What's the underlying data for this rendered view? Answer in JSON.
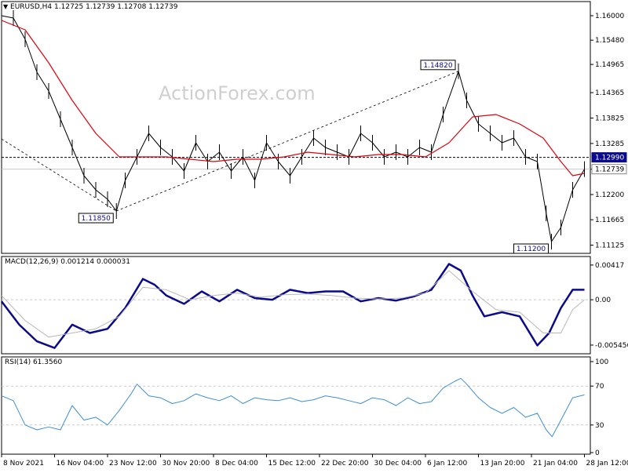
{
  "header": {
    "arrow": "▼",
    "symbol": "EURUSD,H4",
    "ohlc": "1.12725 1.12739 1.12708 1.12739"
  },
  "watermark": "ActionForex.com",
  "chart_data": [
    {
      "type": "line",
      "panel": "price",
      "ylim": [
        1.1095,
        1.163
      ],
      "yticks": [
        "1.16000",
        "1.15480",
        "1.14965",
        "1.14365",
        "1.13825",
        "1.13285",
        "1.12740",
        "1.12200",
        "1.11665",
        "1.11125"
      ],
      "ytick_values": [
        1.16,
        1.1548,
        1.14965,
        1.14365,
        1.13825,
        1.13285,
        1.1274,
        1.122,
        1.11665,
        1.11125
      ],
      "price_labels": [
        {
          "text": "1.12990",
          "value": 1.1299,
          "style": "dark"
        },
        {
          "text": "1.12739",
          "value": 1.12739,
          "style": "light"
        }
      ],
      "horizontal_line": 1.1299,
      "current_line": 1.12739,
      "annotations": [
        {
          "text": "1.11850",
          "value": 1.1185,
          "x": 0.195
        },
        {
          "text": "1.14820",
          "value": 1.1482,
          "x": 0.776
        },
        {
          "text": "1.11200",
          "value": 1.112,
          "x": 0.934
        }
      ],
      "trendlines": [
        {
          "from": [
            0.0,
            1.1338
          ],
          "to": [
            0.195,
            1.1185
          ]
        },
        {
          "from": [
            0.195,
            1.1185
          ],
          "to": [
            0.776,
            1.1482
          ]
        }
      ],
      "series": [
        {
          "key": "price",
          "color": "#000000",
          "x": [
            0.0,
            0.02,
            0.04,
            0.06,
            0.08,
            0.1,
            0.12,
            0.14,
            0.16,
            0.18,
            0.195,
            0.21,
            0.23,
            0.25,
            0.27,
            0.29,
            0.31,
            0.33,
            0.35,
            0.37,
            0.39,
            0.41,
            0.43,
            0.45,
            0.47,
            0.49,
            0.51,
            0.53,
            0.55,
            0.57,
            0.59,
            0.61,
            0.63,
            0.65,
            0.67,
            0.69,
            0.71,
            0.73,
            0.75,
            0.776,
            0.79,
            0.81,
            0.83,
            0.85,
            0.87,
            0.89,
            0.91,
            0.925,
            0.934,
            0.95,
            0.97,
            0.99
          ],
          "values": [
            1.16,
            1.1595,
            1.155,
            1.148,
            1.144,
            1.138,
            1.132,
            1.126,
            1.123,
            1.121,
            1.1185,
            1.125,
            1.13,
            1.135,
            1.132,
            1.13,
            1.127,
            1.133,
            1.129,
            1.131,
            1.127,
            1.13,
            1.125,
            1.133,
            1.129,
            1.126,
            1.13,
            1.134,
            1.132,
            1.131,
            1.13,
            1.135,
            1.133,
            1.13,
            1.131,
            1.13,
            1.132,
            1.131,
            1.139,
            1.1482,
            1.142,
            1.137,
            1.135,
            1.133,
            1.134,
            1.13,
            1.129,
            1.118,
            1.112,
            1.115,
            1.123,
            1.1274
          ]
        },
        {
          "key": "moving-average",
          "color": "#e0000c",
          "x": [
            0.0,
            0.04,
            0.08,
            0.12,
            0.16,
            0.2,
            0.24,
            0.28,
            0.32,
            0.36,
            0.4,
            0.44,
            0.48,
            0.52,
            0.56,
            0.6,
            0.64,
            0.68,
            0.72,
            0.76,
            0.8,
            0.84,
            0.88,
            0.92,
            0.95,
            0.97,
            0.99
          ],
          "values": [
            1.159,
            1.157,
            1.15,
            1.142,
            1.135,
            1.13,
            1.13,
            1.13,
            1.1295,
            1.129,
            1.1295,
            1.1295,
            1.13,
            1.131,
            1.1305,
            1.13,
            1.1305,
            1.1305,
            1.13,
            1.133,
            1.1385,
            1.139,
            1.137,
            1.134,
            1.129,
            1.126,
            1.1265
          ]
        }
      ]
    },
    {
      "type": "line",
      "panel": "macd",
      "title": "MACD(12,26,9) 0.001214 0.000031",
      "ylim": [
        -0.0065,
        0.0052
      ],
      "yticks": [
        "0.00417",
        "0.00",
        "-0.005456"
      ],
      "ytick_values": [
        0.00417,
        0.0,
        -0.005456
      ],
      "series": [
        {
          "key": "macd-main",
          "color": "#0a0a8c",
          "x": [
            0.0,
            0.03,
            0.06,
            0.09,
            0.12,
            0.15,
            0.18,
            0.21,
            0.24,
            0.26,
            0.28,
            0.31,
            0.34,
            0.37,
            0.4,
            0.43,
            0.46,
            0.49,
            0.52,
            0.55,
            0.58,
            0.61,
            0.64,
            0.67,
            0.7,
            0.73,
            0.76,
            0.78,
            0.8,
            0.82,
            0.85,
            0.88,
            0.91,
            0.93,
            0.95,
            0.97,
            0.99
          ],
          "values": [
            -0.0002,
            -0.003,
            -0.005,
            -0.0058,
            -0.003,
            -0.004,
            -0.0035,
            -0.001,
            0.0025,
            0.0018,
            0.0005,
            -0.0005,
            0.001,
            -0.0002,
            0.0012,
            0.0002,
            0.0,
            0.0012,
            0.0008,
            0.001,
            0.001,
            -0.0002,
            0.0002,
            -0.0001,
            0.0004,
            0.0012,
            0.0043,
            0.0035,
            0.0005,
            -0.002,
            -0.0015,
            -0.002,
            -0.0055,
            -0.004,
            -0.001,
            0.0012,
            0.0012
          ]
        },
        {
          "key": "macd-signal",
          "color": "#b8b8b8",
          "x": [
            0.0,
            0.04,
            0.08,
            0.12,
            0.16,
            0.2,
            0.24,
            0.28,
            0.32,
            0.36,
            0.4,
            0.44,
            0.48,
            0.52,
            0.56,
            0.6,
            0.64,
            0.68,
            0.72,
            0.76,
            0.8,
            0.84,
            0.88,
            0.92,
            0.95,
            0.97,
            0.99
          ],
          "values": [
            0.0005,
            -0.0025,
            -0.0045,
            -0.004,
            -0.0035,
            -0.002,
            0.0015,
            0.0012,
            0.0,
            0.0005,
            0.0008,
            0.0003,
            0.0006,
            0.0007,
            0.0005,
            0.0002,
            0.0001,
            0.0002,
            0.0008,
            0.0035,
            0.001,
            -0.0012,
            -0.0015,
            -0.004,
            -0.004,
            -0.0012,
            0.0
          ]
        }
      ]
    },
    {
      "type": "line",
      "panel": "rsi",
      "title": "RSI(14) 61.3560",
      "ylim": [
        0,
        100
      ],
      "yticks": [
        "100",
        "70",
        "30",
        "0"
      ],
      "ytick_values": [
        100,
        70,
        30,
        0
      ],
      "levels": [
        70,
        30
      ],
      "series": [
        {
          "key": "rsi",
          "color": "#3d8fd6",
          "x": [
            0.0,
            0.02,
            0.04,
            0.06,
            0.08,
            0.1,
            0.12,
            0.14,
            0.16,
            0.18,
            0.2,
            0.22,
            0.23,
            0.25,
            0.27,
            0.29,
            0.31,
            0.33,
            0.35,
            0.37,
            0.39,
            0.41,
            0.43,
            0.45,
            0.47,
            0.49,
            0.51,
            0.53,
            0.55,
            0.57,
            0.59,
            0.61,
            0.63,
            0.65,
            0.67,
            0.69,
            0.71,
            0.73,
            0.75,
            0.77,
            0.78,
            0.79,
            0.81,
            0.83,
            0.85,
            0.87,
            0.89,
            0.91,
            0.925,
            0.935,
            0.95,
            0.97,
            0.99
          ],
          "values": [
            60,
            55,
            30,
            25,
            28,
            25,
            50,
            35,
            38,
            30,
            45,
            62,
            72,
            60,
            58,
            52,
            55,
            62,
            58,
            55,
            60,
            52,
            58,
            56,
            55,
            58,
            54,
            56,
            60,
            58,
            55,
            52,
            58,
            56,
            50,
            58,
            52,
            54,
            68,
            75,
            78,
            72,
            58,
            48,
            42,
            48,
            38,
            42,
            25,
            18,
            35,
            58,
            61
          ]
        }
      ]
    }
  ],
  "x_axis": {
    "labels": [
      "8 Nov 2021",
      "16 Nov 04:00",
      "23 Nov 12:00",
      "30 Nov 20:00",
      "8 Dec 04:00",
      "15 Dec 12:00",
      "22 Dec 20:00",
      "30 Dec 04:00",
      "6 Jan 12:00",
      "13 Jan 20:00",
      "21 Jan 04:00",
      "28 Jan 12:00"
    ],
    "positions": [
      0.0,
      0.09,
      0.18,
      0.27,
      0.36,
      0.45,
      0.54,
      0.63,
      0.72,
      0.81,
      0.9,
      0.99
    ]
  },
  "colors": {
    "price": "#000000",
    "moving_average": "#e0000c",
    "macd_main": "#0a0a8c",
    "macd_signal": "#b8b8b8",
    "rsi": "#3d8fd6",
    "label_dark_bg": "#0a0a8c",
    "label_light_bg": "#ffffff",
    "grid": "#c8c8c8"
  }
}
